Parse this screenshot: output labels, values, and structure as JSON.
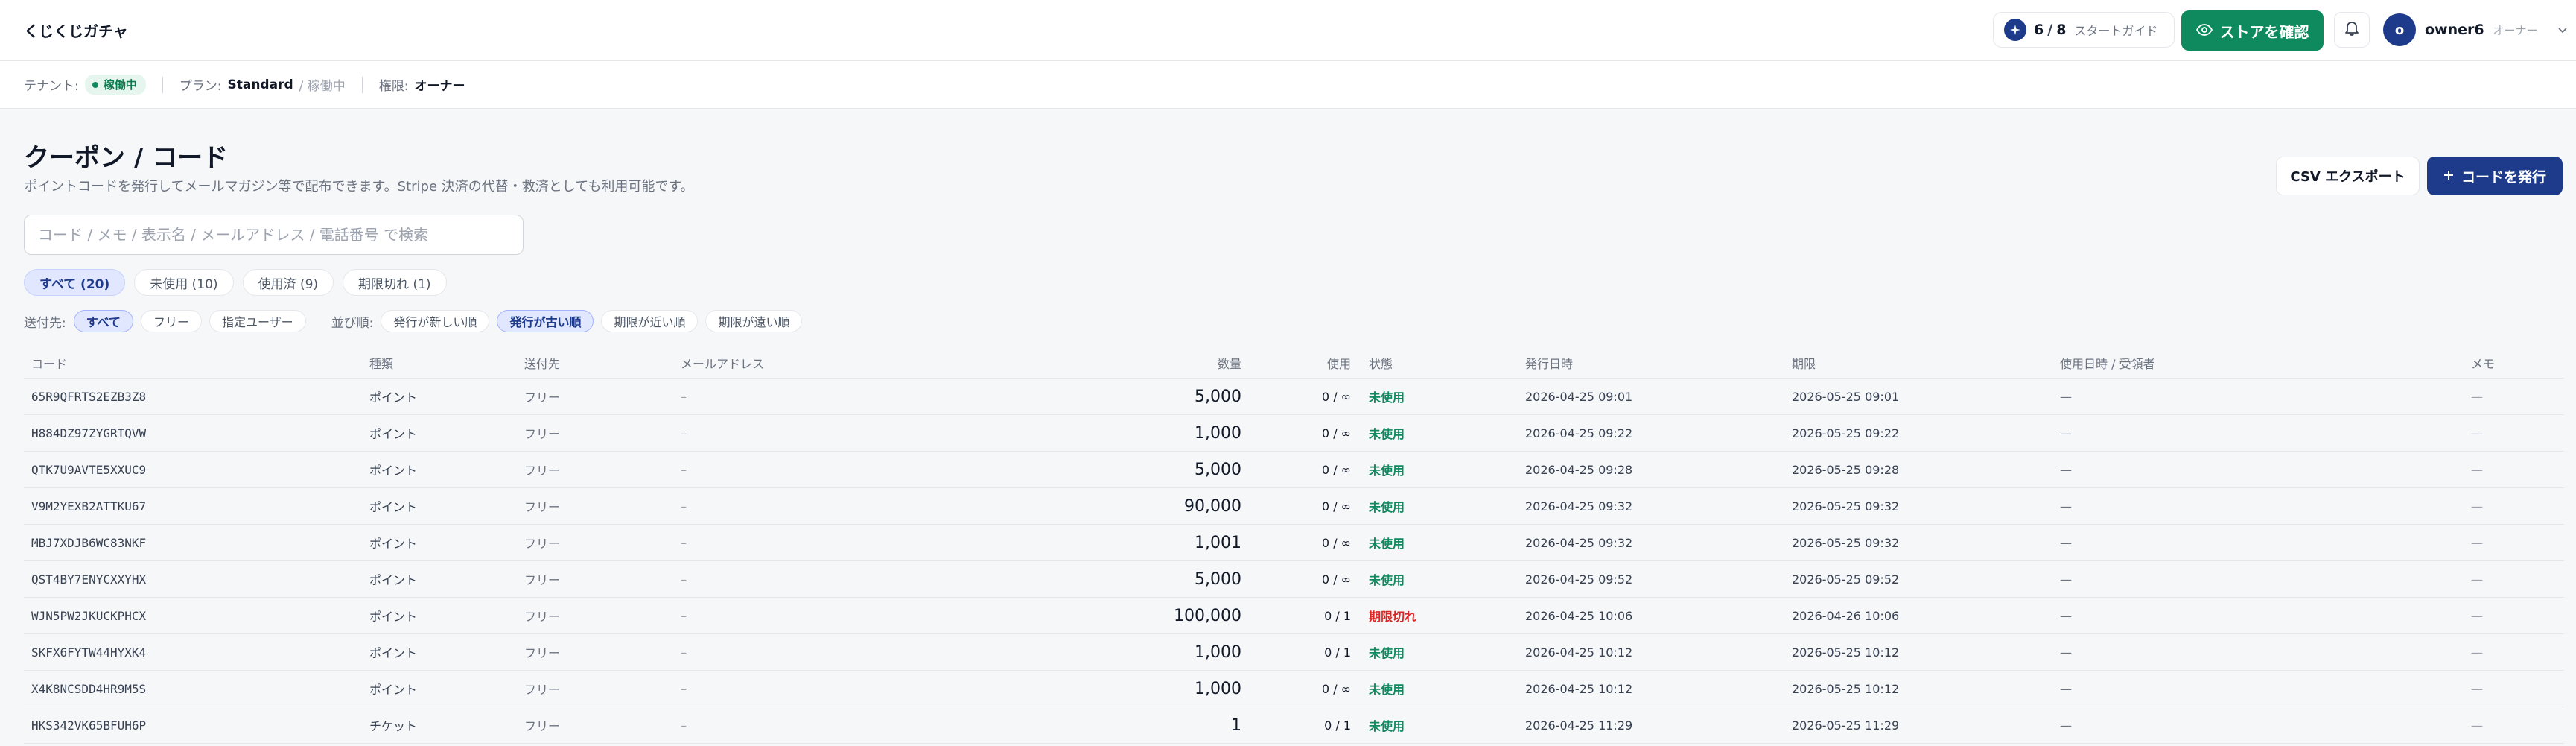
{
  "app": {
    "title": "くじくじガチャ"
  },
  "header": {
    "guide_done": "6",
    "guide_slash": "/",
    "guide_total": "8",
    "guide_label": "スタートガイド",
    "store_button": "ストアを確認",
    "user_initial": "o",
    "user_name": "owner6",
    "user_role": "オーナー"
  },
  "subheader": {
    "tenant_label": "テナント:",
    "tenant_status": "稼働中",
    "plan_label": "プラン:",
    "plan_name": "Standard",
    "plan_status": "/ 稼働中",
    "role_label": "権限:",
    "role_value": "オーナー"
  },
  "page": {
    "title": "クーポン / コード",
    "description": "ポイントコードを発行してメールマガジン等で配布できます。Stripe 決済の代替・救済としても利用可能です。",
    "csv_button": "CSV エクスポート",
    "issue_button": "コードを発行"
  },
  "search": {
    "placeholder": "コード / メモ / 表示名 / メールアドレス / 電話番号 で検索",
    "value": ""
  },
  "tabs": [
    {
      "label": "すべて (20)",
      "active": true
    },
    {
      "label": "未使用 (10)",
      "active": false
    },
    {
      "label": "使用済 (9)",
      "active": false
    },
    {
      "label": "期限切れ (1)",
      "active": false
    }
  ],
  "filters": {
    "dest_label": "送付先:",
    "dest_options": [
      {
        "label": "すべて",
        "active": true
      },
      {
        "label": "フリー",
        "active": false
      },
      {
        "label": "指定ユーザー",
        "active": false
      }
    ],
    "sort_label": "並び順:",
    "sort_options": [
      {
        "label": "発行が新しい順",
        "active": false
      },
      {
        "label": "発行が古い順",
        "active": true
      },
      {
        "label": "期限が近い順",
        "active": false
      },
      {
        "label": "期限が遠い順",
        "active": false
      }
    ]
  },
  "table": {
    "columns": {
      "code": "コード",
      "type": "種類",
      "dest": "送付先",
      "mail": "メールアドレス",
      "amount": "数量",
      "use": "使用",
      "status": "状態",
      "issued": "発行日時",
      "expiry": "期限",
      "used": "使用日時 / 受領者",
      "memo": "メモ"
    },
    "rows": [
      {
        "code": "65R9QFRTS2EZB3Z8",
        "type": "ポイント",
        "dest": "フリー",
        "mail": "–",
        "amount": "5,000",
        "use": "0 / ∞",
        "status": "未使用",
        "issued": "2026-04-25 09:01",
        "expiry": "2026-05-25 09:01",
        "used": "—",
        "memo": "—"
      },
      {
        "code": "H884DZ97ZYGRTQVW",
        "type": "ポイント",
        "dest": "フリー",
        "mail": "–",
        "amount": "1,000",
        "use": "0 / ∞",
        "status": "未使用",
        "issued": "2026-04-25 09:22",
        "expiry": "2026-05-25 09:22",
        "used": "—",
        "memo": "—"
      },
      {
        "code": "QTK7U9AVTE5XXUC9",
        "type": "ポイント",
        "dest": "フリー",
        "mail": "–",
        "amount": "5,000",
        "use": "0 / ∞",
        "status": "未使用",
        "issued": "2026-04-25 09:28",
        "expiry": "2026-05-25 09:28",
        "used": "—",
        "memo": "—"
      },
      {
        "code": "V9M2YEXB2ATTKU67",
        "type": "ポイント",
        "dest": "フリー",
        "mail": "–",
        "amount": "90,000",
        "use": "0 / ∞",
        "status": "未使用",
        "issued": "2026-04-25 09:32",
        "expiry": "2026-05-25 09:32",
        "used": "—",
        "memo": "—"
      },
      {
        "code": "MBJ7XDJB6WC83NKF",
        "type": "ポイント",
        "dest": "フリー",
        "mail": "–",
        "amount": "1,001",
        "use": "0 / ∞",
        "status": "未使用",
        "issued": "2026-04-25 09:32",
        "expiry": "2026-05-25 09:32",
        "used": "—",
        "memo": "—"
      },
      {
        "code": "QST4BY7ENYCXXYHX",
        "type": "ポイント",
        "dest": "フリー",
        "mail": "–",
        "amount": "5,000",
        "use": "0 / ∞",
        "status": "未使用",
        "issued": "2026-04-25 09:52",
        "expiry": "2026-05-25 09:52",
        "used": "—",
        "memo": "—"
      },
      {
        "code": "WJN5PW2JKUCKPHCX",
        "type": "ポイント",
        "dest": "フリー",
        "mail": "–",
        "amount": "100,000",
        "use": "0 / 1",
        "status": "期限切れ",
        "issued": "2026-04-25 10:06",
        "expiry": "2026-04-26 10:06",
        "used": "—",
        "memo": "—"
      },
      {
        "code": "SKFX6FYTW44HYXK4",
        "type": "ポイント",
        "dest": "フリー",
        "mail": "–",
        "amount": "1,000",
        "use": "0 / 1",
        "status": "未使用",
        "issued": "2026-04-25 10:12",
        "expiry": "2026-05-25 10:12",
        "used": "—",
        "memo": "—"
      },
      {
        "code": "X4K8NCSDD4HR9M5S",
        "type": "ポイント",
        "dest": "フリー",
        "mail": "–",
        "amount": "1,000",
        "use": "0 / ∞",
        "status": "未使用",
        "issued": "2026-04-25 10:12",
        "expiry": "2026-05-25 10:12",
        "used": "—",
        "memo": "—"
      },
      {
        "code": "HKS342VK65BFUH6P",
        "type": "チケット",
        "dest": "フリー",
        "mail": "–",
        "amount": "1",
        "use": "0 / 1",
        "status": "未使用",
        "issued": "2026-04-25 11:29",
        "expiry": "2026-05-25 11:29",
        "used": "—",
        "memo": "—"
      }
    ]
  },
  "colors": {
    "brand_navy": "#1e3a8a",
    "store_green": "#0f8a5f",
    "status_unused": "#0f8a5f",
    "status_expired": "#dc2626"
  },
  "icons": {
    "guide": "sparkle-icon",
    "store": "eye-icon",
    "bell": "bell-icon",
    "chevron": "chevron-down-icon",
    "plus": "plus-icon"
  }
}
